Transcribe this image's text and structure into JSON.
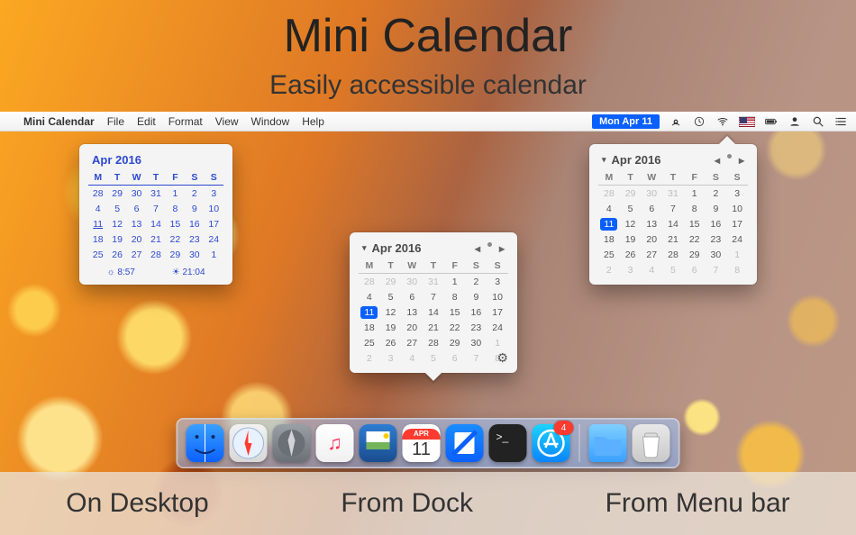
{
  "hero": {
    "title": "Mini Calendar",
    "subtitle": "Easily accessible calendar"
  },
  "menubar": {
    "app_name": "Mini Calendar",
    "items": [
      "File",
      "Edit",
      "Format",
      "View",
      "Window",
      "Help"
    ],
    "date": "Mon Apr 11"
  },
  "calendar": {
    "month_label": "Apr 2016",
    "day_headers": [
      "M",
      "T",
      "W",
      "T",
      "F",
      "S",
      "S"
    ],
    "weeks": [
      [
        {
          "d": "28",
          "o": true
        },
        {
          "d": "29",
          "o": true
        },
        {
          "d": "30",
          "o": true
        },
        {
          "d": "31",
          "o": true
        },
        {
          "d": "1"
        },
        {
          "d": "2"
        },
        {
          "d": "3"
        }
      ],
      [
        {
          "d": "4"
        },
        {
          "d": "5"
        },
        {
          "d": "6"
        },
        {
          "d": "7"
        },
        {
          "d": "8"
        },
        {
          "d": "9"
        },
        {
          "d": "10"
        }
      ],
      [
        {
          "d": "11",
          "t": true
        },
        {
          "d": "12"
        },
        {
          "d": "13"
        },
        {
          "d": "14"
        },
        {
          "d": "15"
        },
        {
          "d": "16"
        },
        {
          "d": "17"
        }
      ],
      [
        {
          "d": "18"
        },
        {
          "d": "19"
        },
        {
          "d": "20"
        },
        {
          "d": "21"
        },
        {
          "d": "22"
        },
        {
          "d": "23"
        },
        {
          "d": "24"
        }
      ],
      [
        {
          "d": "25"
        },
        {
          "d": "26"
        },
        {
          "d": "27"
        },
        {
          "d": "28"
        },
        {
          "d": "29"
        },
        {
          "d": "30"
        },
        {
          "d": "1",
          "o": true
        }
      ],
      [
        {
          "d": "2",
          "o": true
        },
        {
          "d": "3",
          "o": true
        },
        {
          "d": "4",
          "o": true
        },
        {
          "d": "5",
          "o": true
        },
        {
          "d": "6",
          "o": true
        },
        {
          "d": "7",
          "o": true
        },
        {
          "d": "8",
          "o": true
        }
      ]
    ],
    "sunrise": "8:57",
    "sunset": "21:04"
  },
  "dock": {
    "cal_month": "APR",
    "cal_day": "11",
    "appstore_badge": "4"
  },
  "labels": {
    "desktop": "On Desktop",
    "dock": "From Dock",
    "menubar": "From Menu bar"
  }
}
